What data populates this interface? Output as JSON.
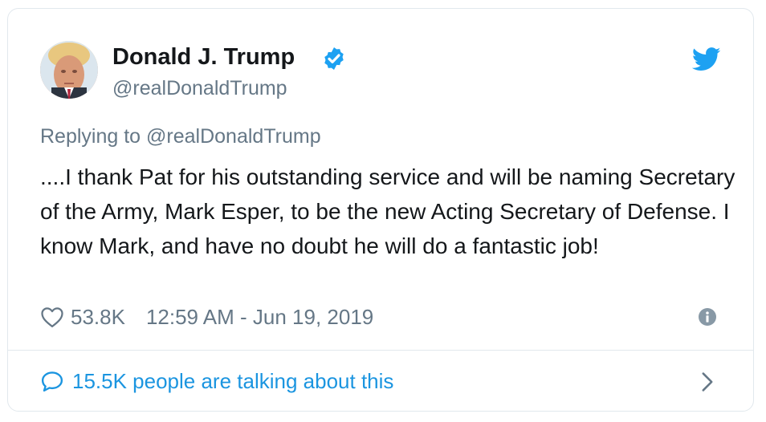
{
  "tweet": {
    "author_name": "Donald J. Trump",
    "handle": "@realDonaldTrump",
    "replying_to_prefix": "Replying to ",
    "replying_to_handle": "@realDonaldTrump",
    "text": "....I thank Pat for his outstanding service and will be naming Secretary of the Army, Mark Esper, to be the new Acting Secretary of Defense. I know Mark, and have no doubt he will do a fantastic job!",
    "likes": "53.8K",
    "timestamp": "12:59 AM - Jun 19, 2019",
    "talking": "15.5K people are talking about this"
  },
  "icons": {
    "verified": "verified-badge-icon",
    "brand": "twitter-bird-icon",
    "like": "heart-icon",
    "info": "info-icon",
    "reply": "speech-bubble-icon",
    "more": "chevron-right-icon"
  },
  "colors": {
    "name": "#14171a",
    "secondary": "#657786",
    "link": "#1b95e0",
    "verified": "#1da1f2",
    "brand": "#1da1f2",
    "border": "#e1e8ed"
  }
}
